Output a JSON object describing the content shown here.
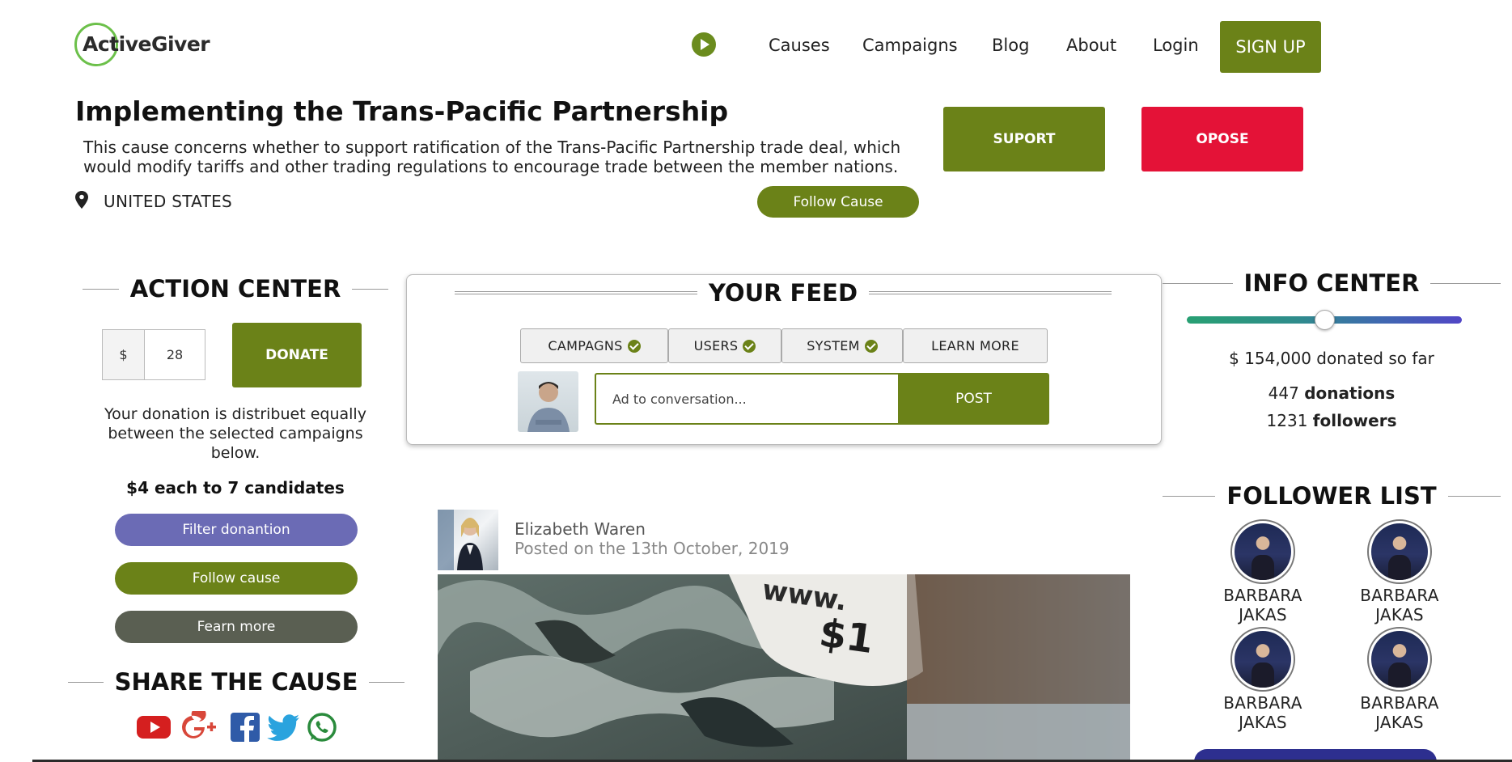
{
  "header": {
    "logo_text": "ActiveGiver",
    "nav": [
      "Causes",
      "Campaigns",
      "Blog",
      "About",
      "Login"
    ],
    "signup_label": "SIGN UP"
  },
  "cause": {
    "title": "Implementing the Trans-Pacific Partnership",
    "description": "This cause concerns whether to support ratification of the Trans-Pacific Partnership trade deal, which would modify tariffs and other trading regulations to encourage trade between the member nations.",
    "location": "UNITED STATES",
    "follow_label": "Follow Cause",
    "support_label": "SUPORT",
    "oppose_label": "OPOSE"
  },
  "action_center": {
    "heading": "ACTION CENTER",
    "currency": "$",
    "amount": "28",
    "donate_label": "DONATE",
    "note": "Your donation is distribuet equally between the selected campaigns below.",
    "per_candidate": "$4 each to 7 candidates",
    "filter_label": "Filter donantion",
    "follow_label": "Follow cause",
    "learn_label": "Fearn more",
    "share_heading": "SHARE THE CAUSE",
    "social_icons": [
      "youtube-icon",
      "google-plus-icon",
      "facebook-icon",
      "twitter-icon",
      "whatsapp-icon"
    ]
  },
  "feed": {
    "heading": "YOUR FEED",
    "tabs": [
      "CAMPAGNS",
      "USERS",
      "SYSTEM",
      "LEARN MORE"
    ],
    "input_placeholder": "Ad to conversation...",
    "post_label": "POST",
    "post": {
      "author": "Elizabeth Waren",
      "date": "Posted on the 13th October, 2019"
    }
  },
  "info_center": {
    "heading": "INFO CENTER",
    "progress_fraction": 0.5,
    "donated_text": "$ 154,000 donated so far",
    "donations_count": "447",
    "donations_label": "donations",
    "followers_count": "1231",
    "followers_label": "followers"
  },
  "followers": {
    "heading": "FOLLOWER LIST",
    "names": [
      "BARBARA JAKAS",
      "BARBARA JAKAS",
      "BARBARA JAKAS",
      "BARBARA JAKAS"
    ]
  },
  "colors": {
    "brand_green": "#6b8218",
    "oppose_red": "#e41237",
    "filter_purple": "#6b6bb5",
    "learn_gray": "#5a5f52"
  }
}
